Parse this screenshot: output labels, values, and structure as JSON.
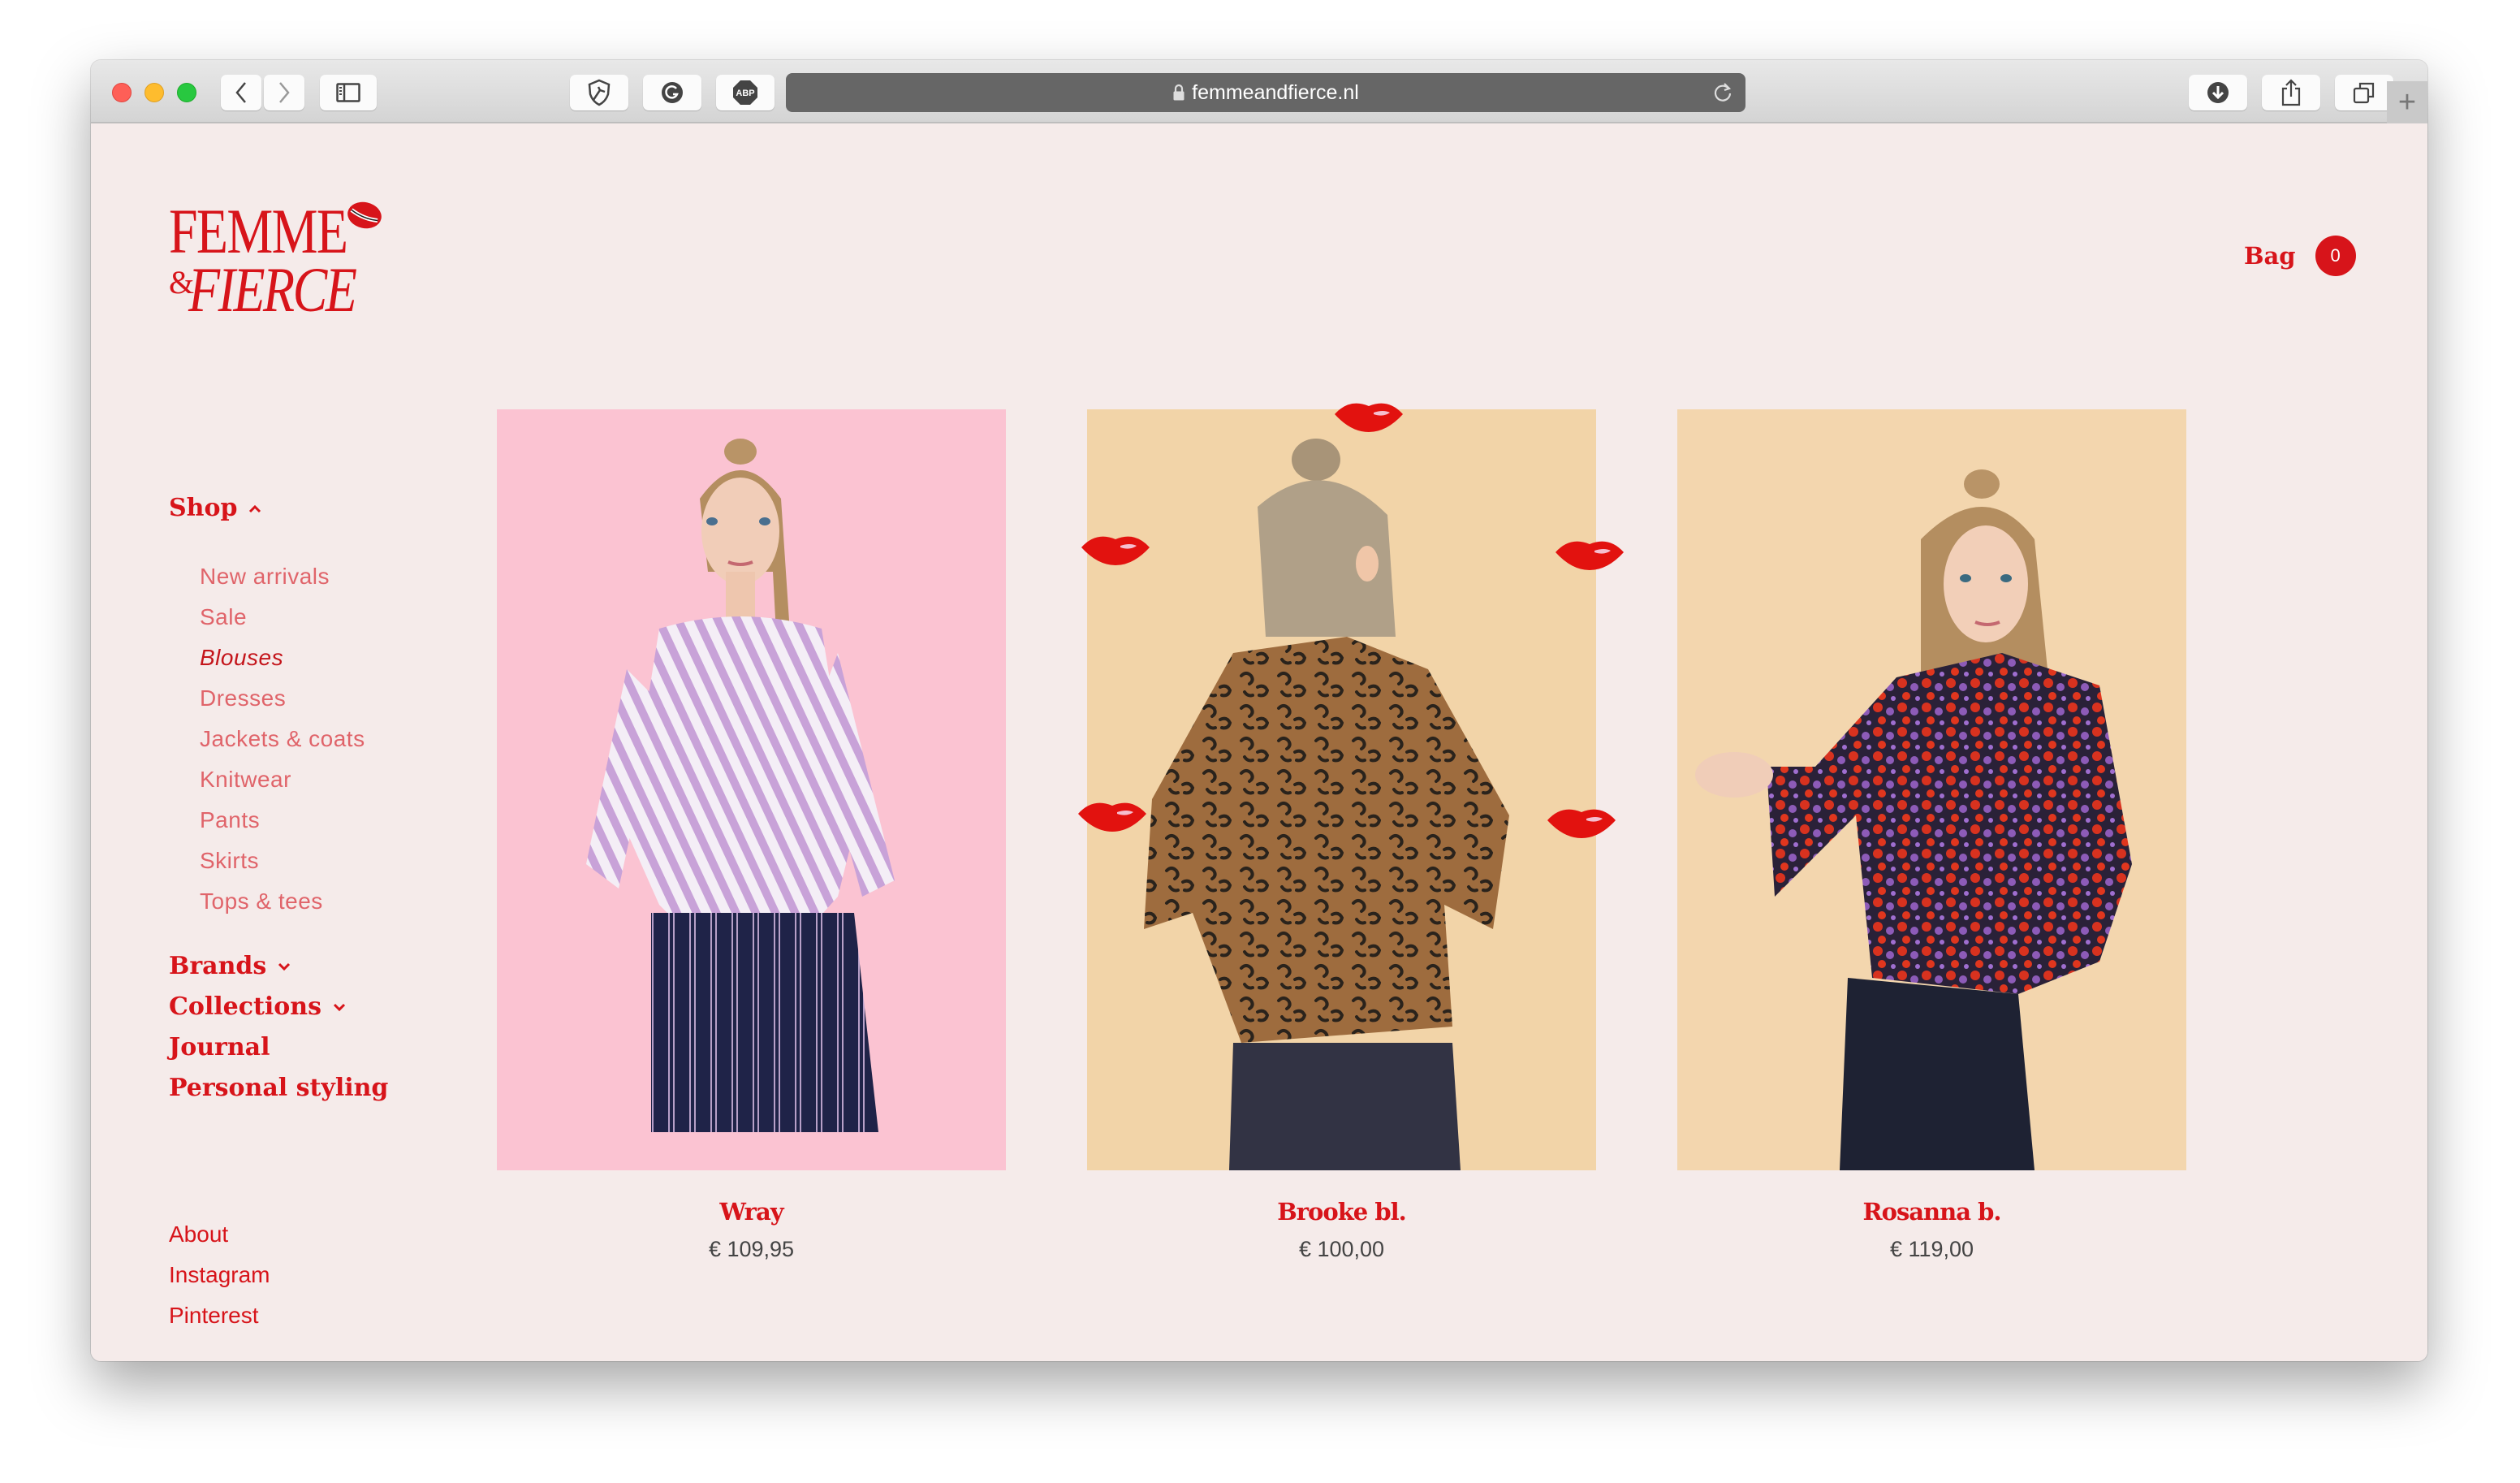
{
  "browser": {
    "url": "femmeandfierce.nl",
    "icons": {
      "back": "chevron-left-icon",
      "forward": "chevron-right-icon",
      "sidebar": "sidebar-icon",
      "ext1": "shield-extension-icon",
      "ext2": "grammarly-icon",
      "ext3": "adblock-plus-icon",
      "lock": "lock-icon",
      "reload": "reload-icon",
      "download": "download-icon",
      "share": "share-icon",
      "tabs": "tab-overview-icon",
      "newtab": "plus-icon"
    },
    "ext3_text": "ABP",
    "newtab_label": "+"
  },
  "brand": {
    "line1": "FEMME",
    "amp": "&",
    "line2": "FIERCE",
    "accent": "#d7141a"
  },
  "header": {
    "bag_label": "Bag",
    "bag_count": "0"
  },
  "sidebar": {
    "shop": {
      "label": "Shop",
      "expanded": true
    },
    "shop_items": [
      {
        "label": "New arrivals",
        "active": false
      },
      {
        "label": "Sale",
        "active": false
      },
      {
        "label": "Blouses",
        "active": true
      },
      {
        "label": "Dresses",
        "active": false
      },
      {
        "label": "Jackets & coats",
        "active": false
      },
      {
        "label": "Knitwear",
        "active": false
      },
      {
        "label": "Pants",
        "active": false
      },
      {
        "label": "Skirts",
        "active": false
      },
      {
        "label": "Tops & tees",
        "active": false
      }
    ],
    "sections": [
      {
        "label": "Brands",
        "has_dropdown": true
      },
      {
        "label": "Collections",
        "has_dropdown": true
      },
      {
        "label": "Journal",
        "has_dropdown": false
      },
      {
        "label": "Personal styling",
        "has_dropdown": false
      }
    ],
    "footer_links": [
      {
        "label": "About"
      },
      {
        "label": "Instagram"
      },
      {
        "label": "Pinterest"
      }
    ]
  },
  "products": [
    {
      "name": "Wray",
      "price": "€ 109,95",
      "background": "#fbc3d2",
      "description": "Model in lilac striped wrap blouse and navy striped skirt"
    },
    {
      "name": "Brooke bl.",
      "price": "€ 100,00",
      "background": "#f2d4a8",
      "description": "Model from behind in sheer leopard print blouse",
      "hover_stickers": true
    },
    {
      "name": "Rosanna b.",
      "price": "€ 119,00",
      "background": "#f3d6ae",
      "description": "Model in red and purple floral blouse with bell sleeves"
    }
  ]
}
